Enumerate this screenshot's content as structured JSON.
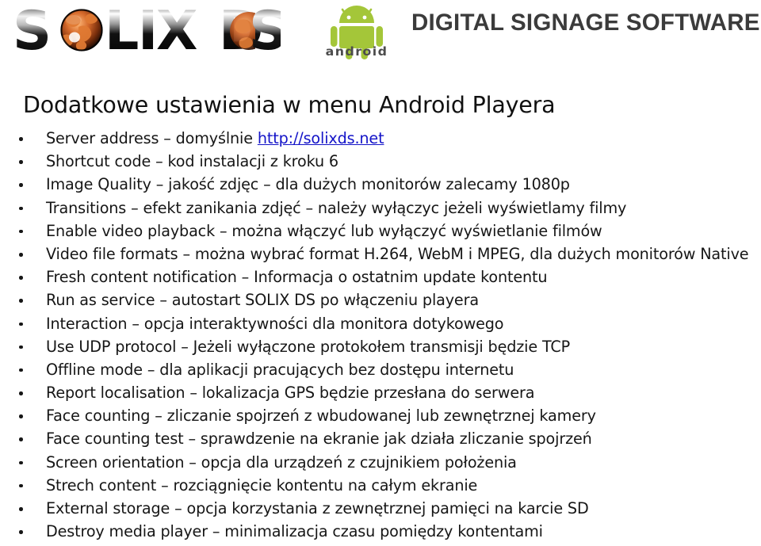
{
  "header": {
    "brand_name": "SOLIX DS",
    "brand_letters": "SOLIX DS",
    "android_wordmark": "android",
    "tagline": "DIGITAL SIGNAGE SOFTWARE",
    "colors": {
      "tagline": "#3b3b3b",
      "android_green": "#a4c639",
      "globe_orange": "#d4682a",
      "link_blue": "#1414c8"
    }
  },
  "page_title": "Dodatkowe ustawienia w menu Android Playera",
  "bullets": [
    {
      "text": "Server address – domyślnie ",
      "link": "http://solixds.net",
      "text_after": ""
    },
    {
      "text": "Shortcut code – kod instalacji z kroku 6"
    },
    {
      "text": "Image Quality – jakość zdjęc – dla dużych monitorów zalecamy 1080p"
    },
    {
      "text": "Transitions – efekt zanikania zdjęć – należy wyłączyc jeżeli wyświetlamy filmy"
    },
    {
      "text": "Enable video playback – można włączyć lub wyłączyć wyświetlanie filmów"
    },
    {
      "text": "Video file formats – można wybrać  format H.264, WebM i MPEG, dla dużych monitorów Native"
    },
    {
      "text": "Fresh content notification – Informacja o ostatnim update kontentu"
    },
    {
      "text": "Run as service – autostart SOLIX DS po włączeniu playera"
    },
    {
      "text": "Interaction – opcja interaktywności dla monitora dotykowego"
    },
    {
      "text": "Use UDP protocol – Jeżeli wyłączone protokołem transmisji będzie TCP"
    },
    {
      "text": "Offline mode – dla aplikacji pracujących bez dostępu internetu"
    },
    {
      "text": "Report localisation – lokalizacja GPS będzie przesłana do serwera"
    },
    {
      "text": "Face counting – zliczanie spojrzeń z wbudowanej lub zewnętrznej kamery"
    },
    {
      "text": "Face counting test – sprawdzenie na ekranie jak działa zliczanie spojrzeń"
    },
    {
      "text": "Screen orientation – opcja dla urządzeń z czujnikiem położenia"
    },
    {
      "text": "Strech content – rozciągnięcie kontentu na całym ekranie"
    },
    {
      "text": "External storage – opcja korzystania z zewnętrznej pamięci na karcie SD"
    },
    {
      "text": "Destroy media player – minimalizacja czasu pomiędzy kontentami"
    }
  ]
}
